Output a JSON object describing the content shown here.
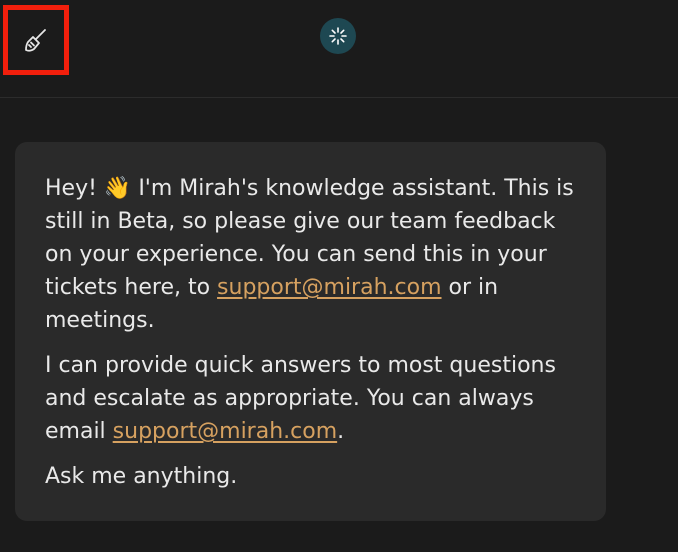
{
  "header": {
    "clear_icon": "broom-icon",
    "logo_icon": "sparkle-logo-icon"
  },
  "message": {
    "p1_greeting": "Hey!",
    "p1_emoji": "👋",
    "p1_text_a": " I'm Mirah's knowledge assistant. This is still in Beta, so please give our team feedback on your experience. You can send this in your tickets here, to ",
    "p1_link": "support@mirah.com",
    "p1_text_b": " or in meetings.",
    "p2_text_a": "I can provide quick answers to most questions and escalate as appropriate. You can always email ",
    "p2_link": "support@mirah.com",
    "p2_text_b": ".",
    "p3_text": "Ask me anything."
  },
  "colors": {
    "background": "#1b1b1b",
    "bubble": "#2a2a2a",
    "link": "#d6a160",
    "highlight_border": "#f21f0c",
    "logo_bg": "#1e4852"
  }
}
